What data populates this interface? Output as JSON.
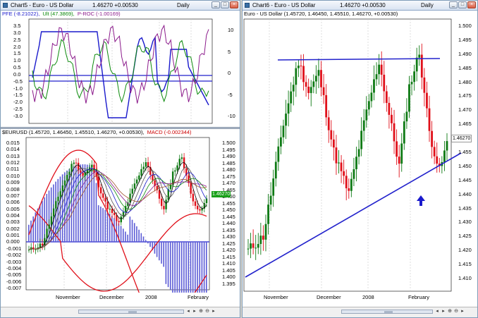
{
  "left_window": {
    "title": "Chart5 - Euro - US Dollar",
    "price": "1.46270 +0.00530",
    "period": "Daily",
    "panel1_labels": {
      "a": "PFE",
      "a_val": "(-8.21022),",
      "b": "Ult",
      "b_val": "(47.3869),",
      "c": "P-ROC",
      "c_val": "(-1.00169)"
    },
    "panel1_left_ticks": [
      "3.5",
      "3.0",
      "2.5",
      "2.0",
      "1.5",
      "1.0",
      "0.5",
      "0.0",
      "-0.5",
      "-1.0",
      "-1.5",
      "-2.0",
      "-2.5",
      "-3.0"
    ],
    "panel1_right_ticks": [
      "10",
      "5",
      "0",
      "-5",
      "-10"
    ],
    "panel2_labels": {
      "a": "$EURUSD",
      "a_val": "(1.45720, 1.46450, 1.45510, 1.46270, +0.00530),",
      "b": "MACD",
      "b_val": "(-0.002344)"
    },
    "panel2_left_ticks": [
      "0.015",
      "0.014",
      "0.013",
      "0.012",
      "0.011",
      "0.010",
      "0.009",
      "0.008",
      "0.007",
      "0.006",
      "0.005",
      "0.004",
      "0.003",
      "0.002",
      "0.001",
      "0.000",
      "-0.001",
      "-0.002",
      "-0.003",
      "-0.004",
      "-0.005",
      "-0.006",
      "-0.007"
    ],
    "panel2_right_ticks": [
      "1.500",
      "1.495",
      "1.490",
      "1.485",
      "1.480",
      "1.475",
      "1.470",
      "1.465",
      "1.460",
      "1.455",
      "1.450",
      "1.445",
      "1.440",
      "1.435",
      "1.430",
      "1.425",
      "1.420",
      "1.415",
      "1.410",
      "1.405",
      "1.400",
      "1.395"
    ],
    "price_badge": "1.46270",
    "x_labels": [
      "November",
      "December",
      "2008",
      "February"
    ]
  },
  "right_window": {
    "title": "Chart6 - Euro - US Dollar",
    "price": "1.46270 +0.00530",
    "period": "Daily",
    "legend": "Euro - US Dollar (1.45720, 1.46450, 1.45510, 1.46270, +0.00530)",
    "right_ticks": [
      "1.500",
      "1.495",
      "1.490",
      "1.485",
      "1.480",
      "1.475",
      "1.470",
      "1.465",
      "1.460",
      "1.455",
      "1.450",
      "1.445",
      "1.440",
      "1.435",
      "1.430",
      "1.425",
      "1.420",
      "1.415",
      "1.410"
    ],
    "price_badge": "1.46270",
    "x_labels": [
      "November",
      "December",
      "2008",
      "February"
    ]
  },
  "colors": {
    "up": "#0e7a14",
    "down": "#e0101a",
    "trendline": "#2222cc",
    "macd_hist": "#5b5bd6"
  },
  "icons": [
    "chart-window-icon",
    "minimize-icon",
    "maximize-icon",
    "close-icon",
    "scroll-left-icon",
    "scroll-right-icon",
    "zoom-in-icon",
    "zoom-out-icon"
  ]
}
